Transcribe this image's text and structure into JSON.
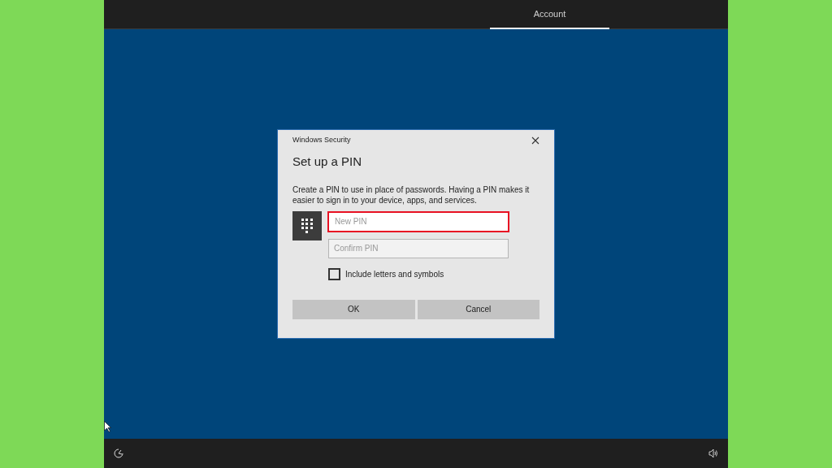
{
  "tabs": [
    {
      "label": "Account",
      "selected": true
    }
  ],
  "dialog": {
    "window_title": "Windows Security",
    "heading": "Set up a PIN",
    "description": "Create a PIN to use in place of passwords. Having a PIN makes it easier to sign in to your device, apps, and services.",
    "fields": [
      {
        "placeholder": "New PIN",
        "focused": true
      },
      {
        "placeholder": "Confirm PIN",
        "focused": false
      }
    ],
    "checkbox": {
      "label": "Include letters and symbols",
      "checked": false
    },
    "buttons": [
      "OK",
      "Cancel"
    ]
  }
}
